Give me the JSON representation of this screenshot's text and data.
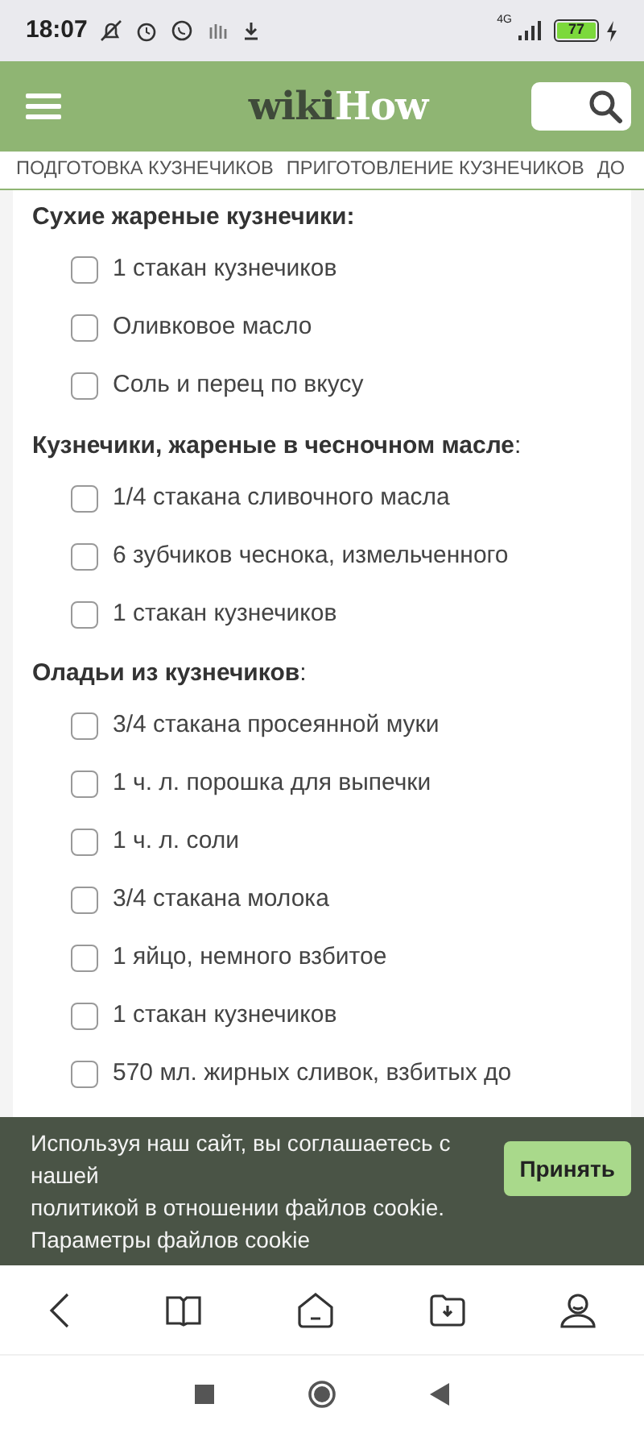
{
  "status_bar": {
    "time": "18:07",
    "network": "4G",
    "battery": "77"
  },
  "header": {
    "logo_dark": "wiki",
    "logo_light": "How"
  },
  "tabs": [
    {
      "label": "ПОДГОТОВКА КУЗНЕЧИКОВ"
    },
    {
      "label": "ПРИГОТОВЛЕНИЕ КУЗНЕЧИКОВ"
    },
    {
      "label": "ДО"
    }
  ],
  "sections": [
    {
      "heading": "**Сухие жареные кузнечики:**",
      "items": [
        {
          "text": "1 стакан кузнечиков",
          "checked": false
        },
        {
          "text": "Оливковое масло",
          "checked": false
        },
        {
          "text": "Соль и перец по вкусу",
          "checked": false
        }
      ]
    },
    {
      "heading": "**Кузнечики, жареные в чесночном масле**:",
      "items": [
        {
          "text": "1/4 стакана сливочного масла",
          "checked": false
        },
        {
          "text": "6 зубчиков чеснока, измельченного",
          "checked": false
        },
        {
          "text": "1 стакан кузнечиков",
          "checked": false
        }
      ]
    },
    {
      "heading": "**Оладьи из кузнечиков**:",
      "items": [
        {
          "text": "3/4 стакана просеянной муки",
          "checked": false
        },
        {
          "text": "1 ч. л. порошка для выпечки",
          "checked": false
        },
        {
          "text": "1 ч. л. соли",
          "checked": false
        },
        {
          "text": "3/4 стакана молока",
          "checked": false
        },
        {
          "text": "1 яйцо, немного взбитое",
          "checked": false
        },
        {
          "text": "1 стакан кузнечиков",
          "checked": false
        },
        {
          "text": "570 мл. жирных сливок, взбитых до",
          "checked": false
        }
      ]
    }
  ],
  "cookie_banner": {
    "parts": [
      {
        "kind": "text",
        "text": "Используя наш сайт, вы соглашаетесь с нашей "
      },
      {
        "kind": "link",
        "text": "политикой в отношении файлов cookie"
      },
      {
        "kind": "text",
        "text": ". "
      },
      {
        "kind": "link",
        "text": "Параметры файлов cookie"
      }
    ],
    "button": "Принять"
  }
}
